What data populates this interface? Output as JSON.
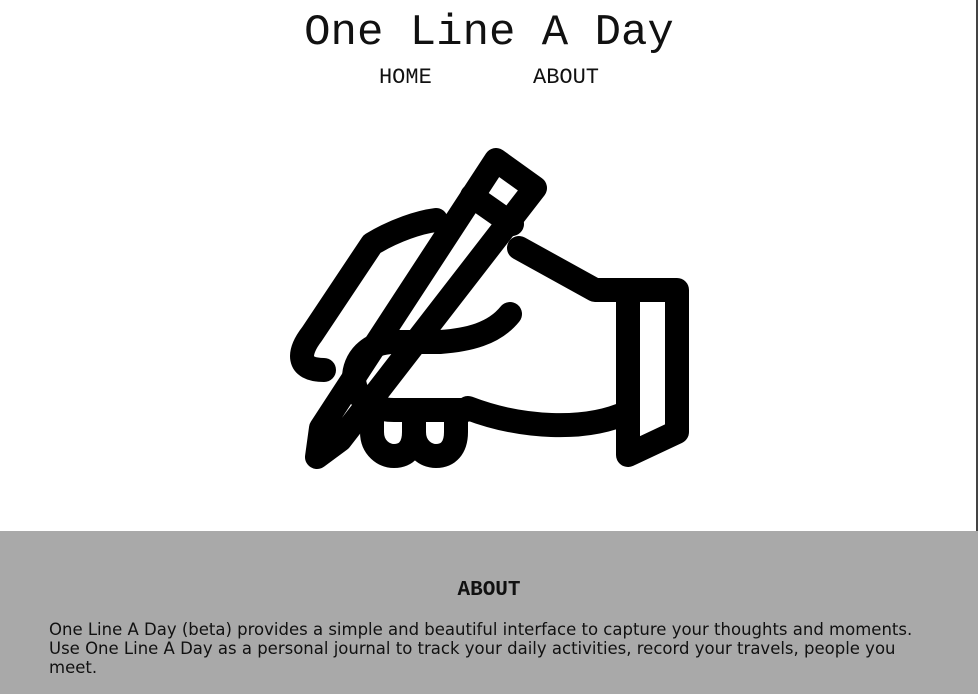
{
  "header": {
    "site_title": "One Line A Day"
  },
  "nav": {
    "items": [
      {
        "label": "HOME"
      },
      {
        "label": "ABOUT"
      }
    ]
  },
  "hero": {
    "icon": "hand-writing-with-pencil-icon"
  },
  "about": {
    "heading": "ABOUT",
    "text": "One Line A Day (beta) provides a simple and beautiful interface to capture your thoughts and moments. Use One Line A Day as a personal journal to track your daily activities, record your travels, people you meet.",
    "background_color": "#a9a9a9"
  }
}
